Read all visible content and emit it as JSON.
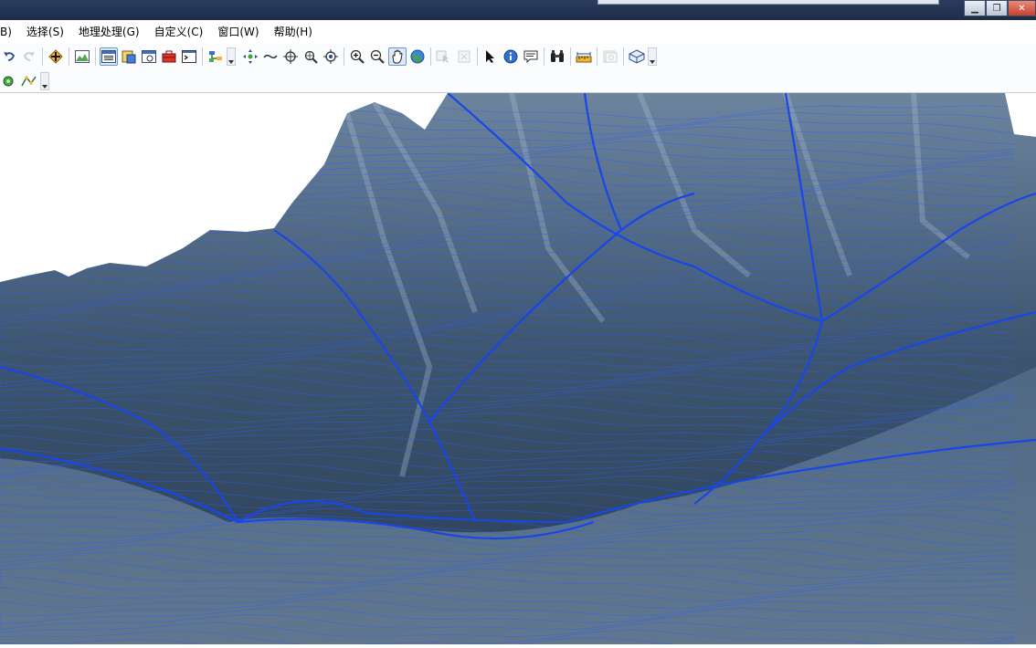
{
  "menubar": {
    "items": [
      {
        "label": "B)"
      },
      {
        "label": "选择(S)"
      },
      {
        "label": "地理处理(G)"
      },
      {
        "label": "自定义(C)"
      },
      {
        "label": "窗口(W)"
      },
      {
        "label": "帮助(H)"
      }
    ]
  },
  "toolbar1": {
    "tools": [
      {
        "name": "undo-button",
        "icon": "undo-arrow",
        "state": "normal"
      },
      {
        "name": "redo-button",
        "icon": "redo-arrow",
        "state": "disabled"
      },
      {
        "name": "add-data-button",
        "icon": "plus-diamond",
        "state": "normal"
      },
      {
        "name": "full-extent-button",
        "icon": "terrain-frame",
        "state": "normal"
      },
      {
        "name": "table-of-contents-button",
        "icon": "window-list",
        "state": "active"
      },
      {
        "name": "catalog-button",
        "icon": "catalog",
        "state": "normal"
      },
      {
        "name": "search-window-button",
        "icon": "window",
        "state": "normal"
      },
      {
        "name": "arctoolbox-button",
        "icon": "red-toolbox",
        "state": "normal"
      },
      {
        "name": "python-window-button",
        "icon": "console",
        "state": "normal"
      },
      {
        "name": "model-builder-button",
        "icon": "model-builder",
        "state": "normal"
      },
      {
        "name": "navigate-button",
        "icon": "navigate",
        "state": "normal"
      },
      {
        "name": "fly-button",
        "icon": "fly",
        "state": "normal"
      },
      {
        "name": "center-target-button",
        "icon": "target-cross",
        "state": "normal"
      },
      {
        "name": "zoom-to-target-button",
        "icon": "zoom-target",
        "state": "normal"
      },
      {
        "name": "set-observer-button",
        "icon": "observer",
        "state": "normal"
      },
      {
        "name": "zoom-in-button",
        "icon": "zoom-in",
        "state": "normal"
      },
      {
        "name": "zoom-out-button",
        "icon": "zoom-out",
        "state": "normal"
      },
      {
        "name": "pan-button",
        "icon": "pan-hand",
        "state": "active"
      },
      {
        "name": "full-extent-globe-button",
        "icon": "globe",
        "state": "normal"
      },
      {
        "name": "select-features-button",
        "icon": "select-features",
        "state": "disabled"
      },
      {
        "name": "clear-selection-button",
        "icon": "clear-selection",
        "state": "disabled"
      },
      {
        "name": "select-elements-button",
        "icon": "arrow-cursor",
        "state": "normal"
      },
      {
        "name": "identify-button",
        "icon": "info",
        "state": "normal"
      },
      {
        "name": "html-popup-button",
        "icon": "popup",
        "state": "normal"
      },
      {
        "name": "find-button",
        "icon": "binoculars",
        "state": "normal"
      },
      {
        "name": "measure-button",
        "icon": "ruler",
        "state": "normal"
      },
      {
        "name": "animation-button",
        "icon": "animation",
        "state": "disabled"
      },
      {
        "name": "scene-properties-button",
        "icon": "scene-box",
        "state": "normal"
      }
    ]
  },
  "toolbar2": {
    "tools": [
      {
        "name": "layer-tool-button",
        "icon": "green-layer",
        "state": "normal"
      },
      {
        "name": "edit-tool-button",
        "icon": "edit-vertices",
        "state": "normal"
      }
    ]
  },
  "colors": {
    "titlebar": "#1d2c48",
    "contour": "#2a5cff",
    "ridge": "#1846e8",
    "terrain_dark": "#1e2a3a",
    "terrain_mid": "#4e6a86",
    "terrain_light": "#9aaec2",
    "sky": "#ffffff"
  }
}
